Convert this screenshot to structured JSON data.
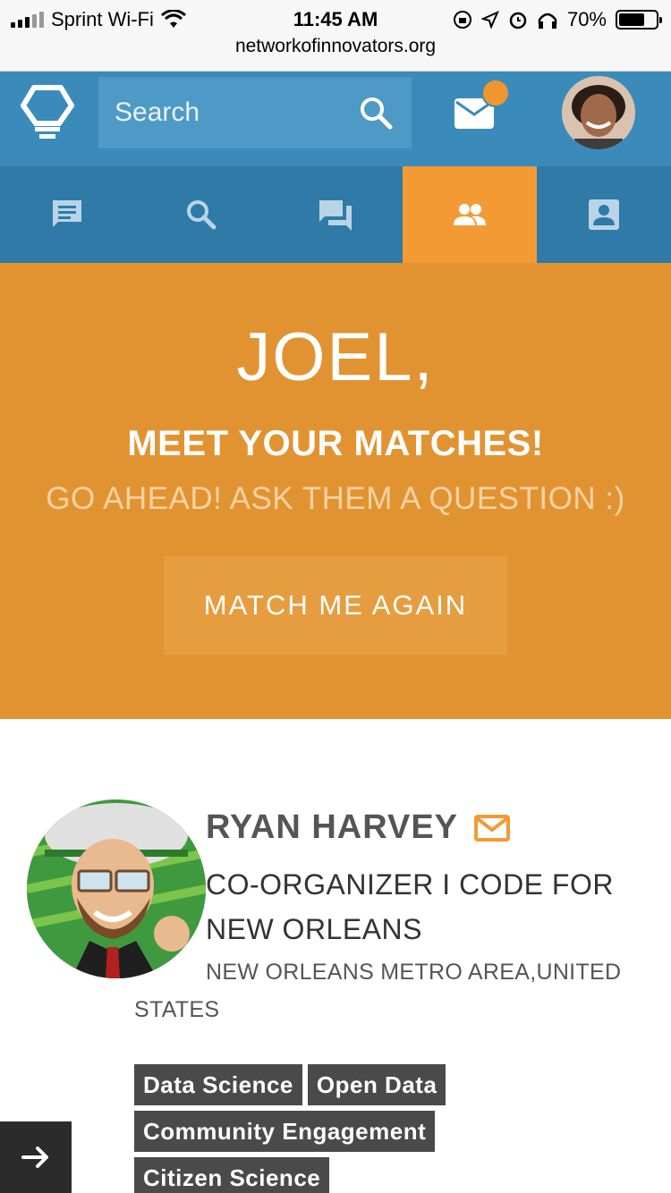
{
  "status_bar": {
    "carrier": "Sprint Wi-Fi",
    "time": "11:45 AM",
    "battery": "70%",
    "battery_level": 0.7,
    "url": "networkofinnovators.org"
  },
  "header": {
    "search_placeholder": "Search",
    "has_unread_messages": true
  },
  "nav": {
    "tabs": [
      {
        "icon": "feed-icon",
        "active": false
      },
      {
        "icon": "search-icon",
        "active": false
      },
      {
        "icon": "chat-icon",
        "active": false
      },
      {
        "icon": "people-icon",
        "active": true
      },
      {
        "icon": "profile-icon",
        "active": false
      }
    ]
  },
  "hero": {
    "greeting": "JOEL,",
    "title": "MEET YOUR MATCHES!",
    "subtitle": "GO AHEAD! ASK THEM A QUESTION :)",
    "button_label": "MATCH ME AGAIN"
  },
  "match": {
    "name": "RYAN HARVEY",
    "role": "CO-ORGANIZER I CODE FOR NEW ORLEANS",
    "location": "NEW ORLEANS METRO AREA,UNITED STATES",
    "tags": [
      "Data Science",
      "Open Data",
      "Community Engagement",
      "Citizen Science"
    ]
  },
  "colors": {
    "header_blue": "#3b8bba",
    "nav_blue": "#2f7aa6",
    "accent_orange": "#f39a35",
    "hero_orange": "#e29331",
    "tag_gray": "#4a4a4a"
  }
}
